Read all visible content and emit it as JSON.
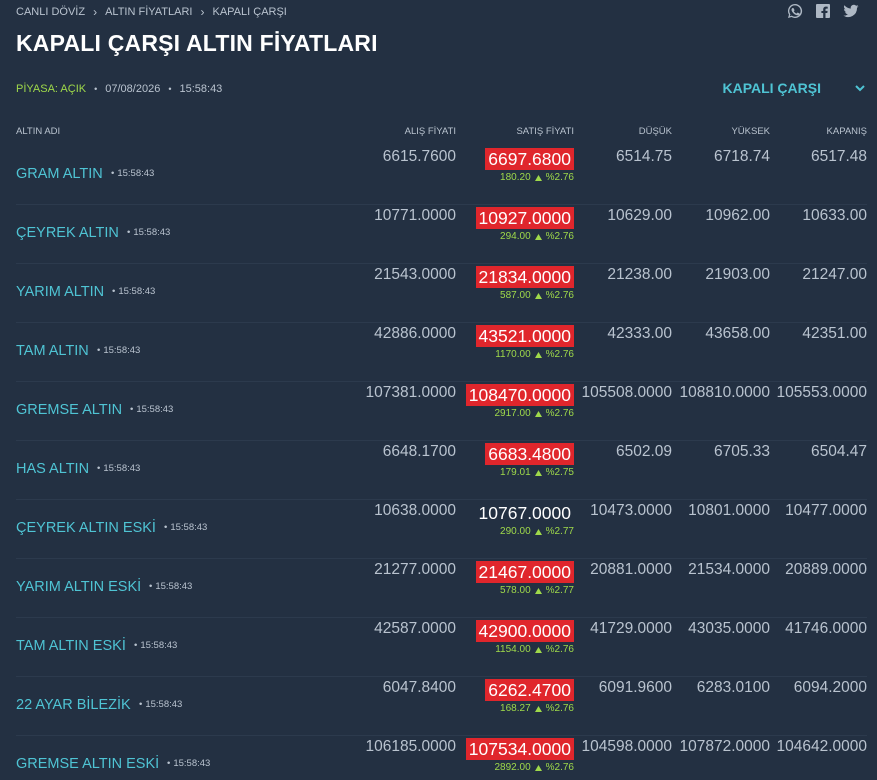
{
  "breadcrumb": [
    "CANLI DÖVİZ",
    "ALTIN FİYATLARI",
    "KAPALI ÇARŞI"
  ],
  "title": "KAPALI ÇARŞI ALTIN FİYATLARI",
  "meta": {
    "market": "PİYASA: AÇIK",
    "date": "07/08/2026",
    "time": "15:58:43"
  },
  "selector": {
    "label": "KAPALI ÇARŞI"
  },
  "share_icons": [
    "whatsapp-icon",
    "facebook-icon",
    "twitter-icon"
  ],
  "columns": {
    "name": "ALTIN ADI",
    "buy": "ALIŞ FİYATI",
    "sell": "SATIŞ FİYATI",
    "low": "DÜŞÜK",
    "high": "YÜKSEK",
    "close": "KAPANIŞ"
  },
  "colors": {
    "background": "#233042",
    "accent": "#4fc4d4",
    "sell_highlight": "#e0262c",
    "up": "#9fd94a"
  },
  "rows": [
    {
      "name": "GRAM ALTIN",
      "time": "15:58:43",
      "buy": "6615.7600",
      "sell": "6697.6800",
      "highlight": true,
      "change": "180.20",
      "pct": "%2.76",
      "low": "6514.75",
      "high": "6718.74",
      "close": "6517.48"
    },
    {
      "name": "ÇEYREK ALTIN",
      "time": "15:58:43",
      "buy": "10771.0000",
      "sell": "10927.0000",
      "highlight": true,
      "change": "294.00",
      "pct": "%2.76",
      "low": "10629.00",
      "high": "10962.00",
      "close": "10633.00"
    },
    {
      "name": "YARIM ALTIN",
      "time": "15:58:43",
      "buy": "21543.0000",
      "sell": "21834.0000",
      "highlight": true,
      "change": "587.00",
      "pct": "%2.76",
      "low": "21238.00",
      "high": "21903.00",
      "close": "21247.00"
    },
    {
      "name": "TAM ALTIN",
      "time": "15:58:43",
      "buy": "42886.0000",
      "sell": "43521.0000",
      "highlight": true,
      "change": "1170.00",
      "pct": "%2.76",
      "low": "42333.00",
      "high": "43658.00",
      "close": "42351.00"
    },
    {
      "name": "GREMSE ALTIN",
      "time": "15:58:43",
      "buy": "107381.0000",
      "sell": "108470.0000",
      "highlight": true,
      "change": "2917.00",
      "pct": "%2.76",
      "low": "105508.0000",
      "high": "108810.0000",
      "close": "105553.0000"
    },
    {
      "name": "HAS ALTIN",
      "time": "15:58:43",
      "buy": "6648.1700",
      "sell": "6683.4800",
      "highlight": true,
      "change": "179.01",
      "pct": "%2.75",
      "low": "6502.09",
      "high": "6705.33",
      "close": "6504.47"
    },
    {
      "name": "ÇEYREK ALTIN ESKİ",
      "time": "15:58:43",
      "buy": "10638.0000",
      "sell": "10767.0000",
      "highlight": false,
      "change": "290.00",
      "pct": "%2.77",
      "low": "10473.0000",
      "high": "10801.0000",
      "close": "10477.0000"
    },
    {
      "name": "YARIM ALTIN ESKİ",
      "time": "15:58:43",
      "buy": "21277.0000",
      "sell": "21467.0000",
      "highlight": true,
      "change": "578.00",
      "pct": "%2.77",
      "low": "20881.0000",
      "high": "21534.0000",
      "close": "20889.0000"
    },
    {
      "name": "TAM ALTIN ESKİ",
      "time": "15:58:43",
      "buy": "42587.0000",
      "sell": "42900.0000",
      "highlight": true,
      "change": "1154.00",
      "pct": "%2.76",
      "low": "41729.0000",
      "high": "43035.0000",
      "close": "41746.0000"
    },
    {
      "name": "22 AYAR BİLEZİK",
      "time": "15:58:43",
      "buy": "6047.8400",
      "sell": "6262.4700",
      "highlight": true,
      "change": "168.27",
      "pct": "%2.76",
      "low": "6091.9600",
      "high": "6283.0100",
      "close": "6094.2000"
    },
    {
      "name": "GREMSE ALTIN ESKİ",
      "time": "15:58:43",
      "buy": "106185.0000",
      "sell": "107534.0000",
      "highlight": true,
      "change": "2892.00",
      "pct": "%2.76",
      "low": "104598.0000",
      "high": "107872.0000",
      "close": "104642.0000"
    }
  ]
}
